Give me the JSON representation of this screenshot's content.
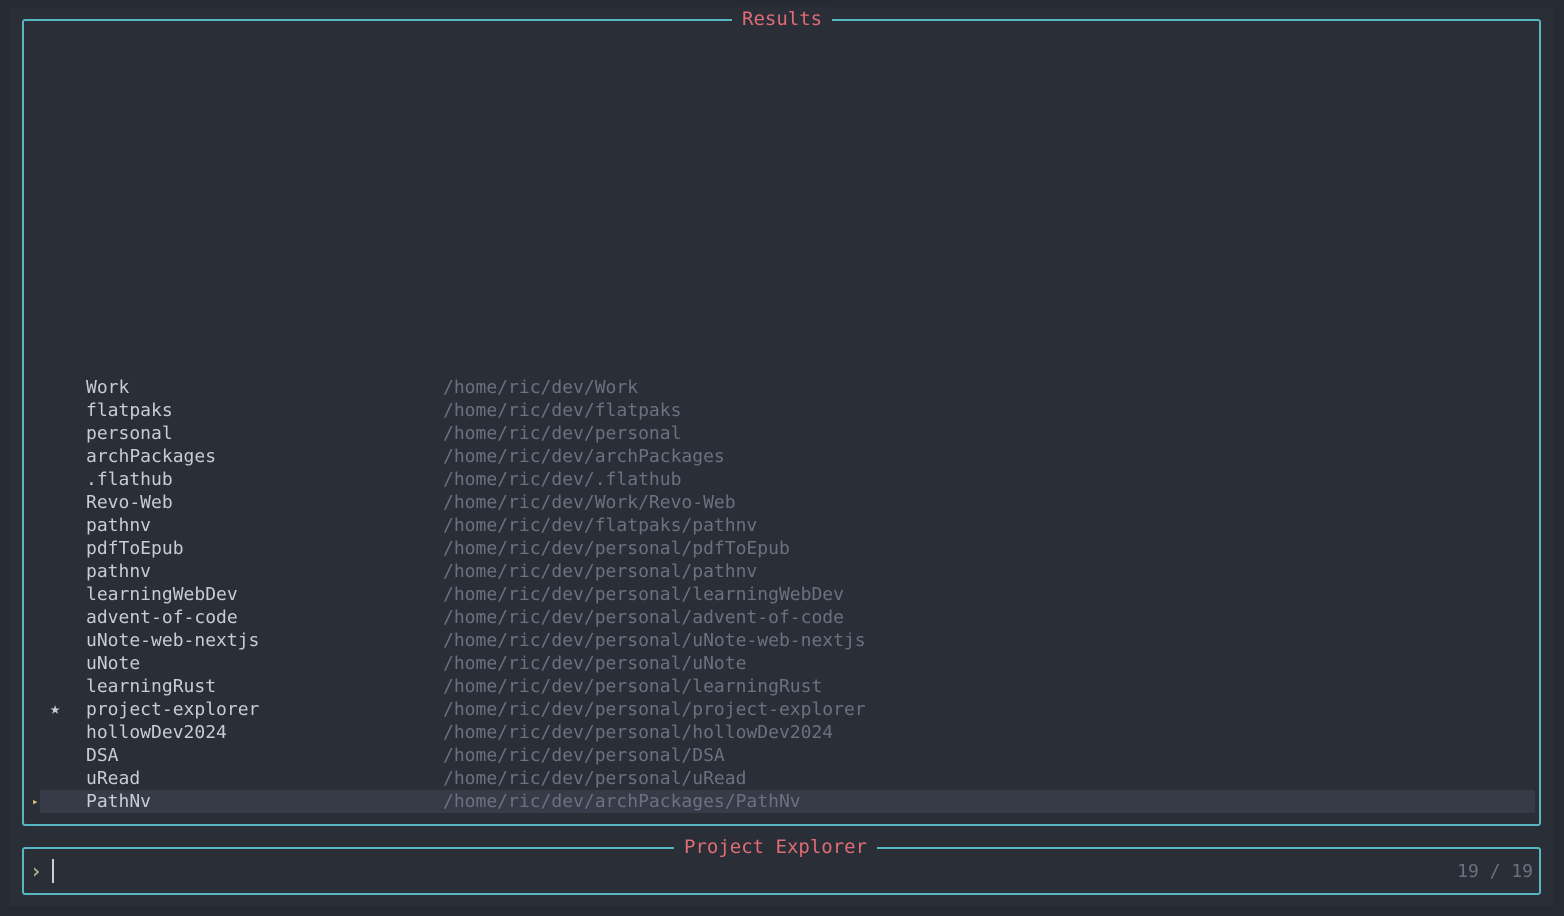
{
  "results_panel": {
    "title": "Results"
  },
  "items": [
    {
      "name": "Work",
      "path": "/home/ric/dev/Work",
      "marker": ""
    },
    {
      "name": "flatpaks",
      "path": "/home/ric/dev/flatpaks",
      "marker": ""
    },
    {
      "name": "personal",
      "path": "/home/ric/dev/personal",
      "marker": ""
    },
    {
      "name": "archPackages",
      "path": "/home/ric/dev/archPackages",
      "marker": ""
    },
    {
      "name": ".flathub",
      "path": "/home/ric/dev/.flathub",
      "marker": ""
    },
    {
      "name": "Revo-Web",
      "path": "/home/ric/dev/Work/Revo-Web",
      "marker": ""
    },
    {
      "name": "pathnv",
      "path": "/home/ric/dev/flatpaks/pathnv",
      "marker": ""
    },
    {
      "name": "pdfToEpub",
      "path": "/home/ric/dev/personal/pdfToEpub",
      "marker": ""
    },
    {
      "name": "pathnv",
      "path": "/home/ric/dev/personal/pathnv",
      "marker": ""
    },
    {
      "name": "learningWebDev",
      "path": "/home/ric/dev/personal/learningWebDev",
      "marker": ""
    },
    {
      "name": "advent-of-code",
      "path": "/home/ric/dev/personal/advent-of-code",
      "marker": ""
    },
    {
      "name": "uNote-web-nextjs",
      "path": "/home/ric/dev/personal/uNote-web-nextjs",
      "marker": ""
    },
    {
      "name": "uNote",
      "path": "/home/ric/dev/personal/uNote",
      "marker": ""
    },
    {
      "name": "learningRust",
      "path": "/home/ric/dev/personal/learningRust",
      "marker": ""
    },
    {
      "name": "project-explorer",
      "path": "/home/ric/dev/personal/project-explorer",
      "marker": "★"
    },
    {
      "name": "hollowDev2024",
      "path": "/home/ric/dev/personal/hollowDev2024",
      "marker": ""
    },
    {
      "name": "DSA",
      "path": "/home/ric/dev/personal/DSA",
      "marker": ""
    },
    {
      "name": "uRead",
      "path": "/home/ric/dev/personal/uRead",
      "marker": ""
    },
    {
      "name": "PathNv",
      "path": "/home/ric/dev/archPackages/PathNv",
      "marker": ""
    }
  ],
  "selected_index": 18,
  "selection_caret": "▸",
  "prompt_panel": {
    "title": "Project Explorer",
    "prompt_symbol": "›",
    "query": "",
    "counter": "19 / 19"
  },
  "colors": {
    "border": "#56b6c2",
    "title": "#e06c75",
    "prompt": "#98c379",
    "caret": "#e5c07b",
    "path": "#6b7180",
    "selection_bg": "#363b47"
  }
}
